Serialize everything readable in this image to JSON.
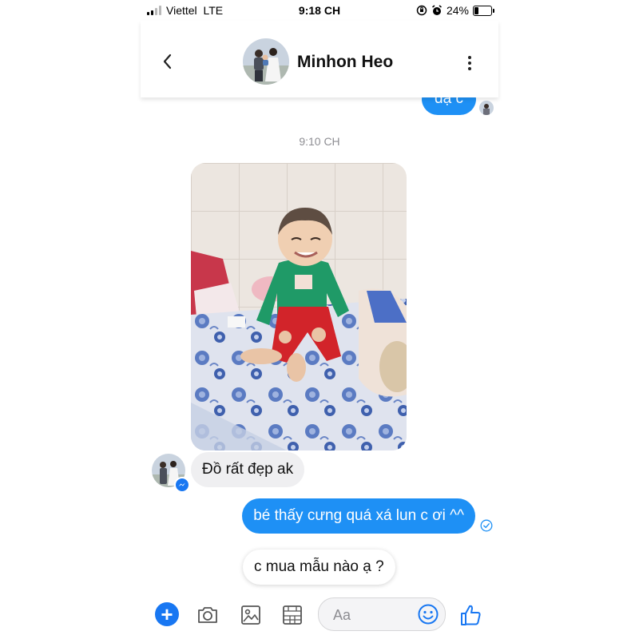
{
  "status_bar": {
    "carrier": "Viettel",
    "network": "LTE",
    "time": "9:18 CH",
    "battery_percent": "24%",
    "battery_level": 0.24
  },
  "header": {
    "contact_name": "Minhon Heo"
  },
  "messages": {
    "previous_outgoing": "dạ c",
    "timestamp": "9:10 CH",
    "incoming_text": "Đồ rất đẹp ak",
    "outgoing_text": "bé thấy cưng quá xá lun c ơi ^^",
    "centered_text": "c mua mẫu nào ạ ?"
  },
  "composer": {
    "placeholder": "Aa"
  },
  "colors": {
    "accent": "#1e90f5",
    "messenger_blue": "#1877f2",
    "incoming_bubble": "#efeff1"
  },
  "icons": [
    "back-icon",
    "more-icon",
    "messenger-badge-icon",
    "check-circle-icon",
    "plus-icon",
    "camera-icon",
    "image-icon",
    "sticker-icon",
    "emoji-icon",
    "thumbs-up-icon"
  ]
}
